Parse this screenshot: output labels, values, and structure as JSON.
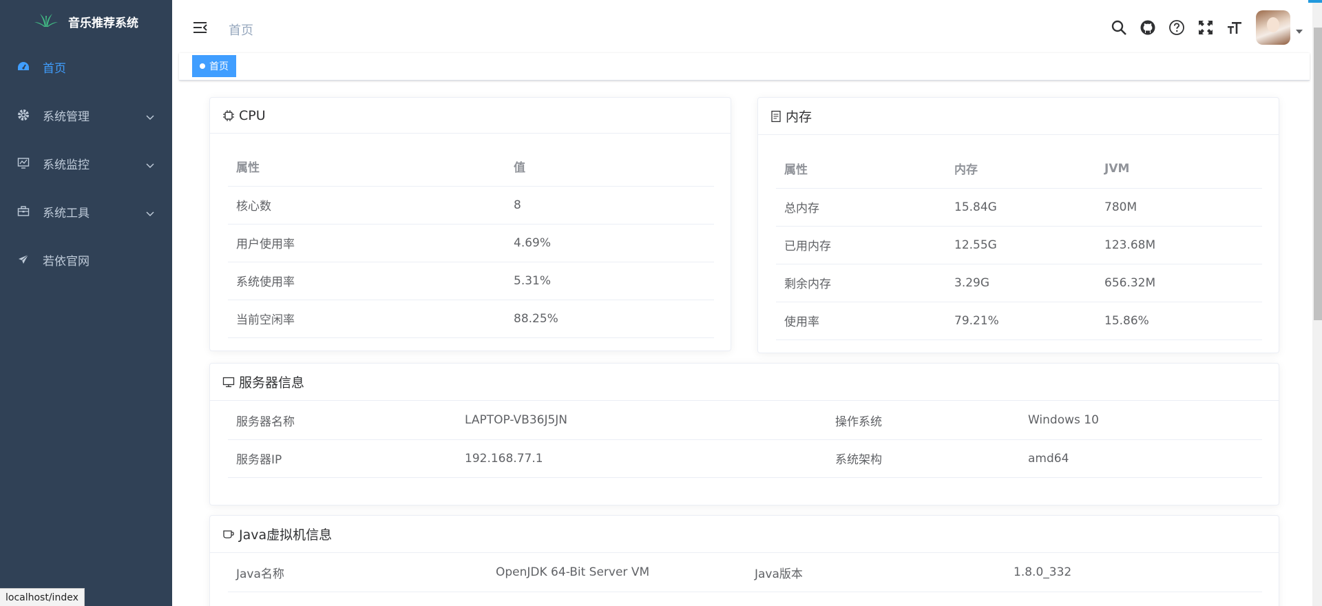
{
  "app": {
    "title": "音乐推荐系统"
  },
  "sidebar": {
    "items": [
      {
        "label": "首页",
        "icon": "dashboard-icon",
        "active": true
      },
      {
        "label": "系统管理",
        "icon": "gear-icon",
        "expandable": true
      },
      {
        "label": "系统监控",
        "icon": "monitor-icon",
        "expandable": true
      },
      {
        "label": "系统工具",
        "icon": "toolbox-icon",
        "expandable": true
      },
      {
        "label": "若依官网",
        "icon": "paper-plane-icon"
      }
    ]
  },
  "header": {
    "breadcrumb": "首页",
    "icons": [
      "search-icon",
      "github-icon",
      "question-icon",
      "fullscreen-icon",
      "font-size-icon"
    ]
  },
  "tags_view": {
    "tags": [
      {
        "label": "首页",
        "active": true
      }
    ]
  },
  "cpu": {
    "title": "CPU",
    "columns": [
      "属性",
      "值"
    ],
    "rows": [
      [
        "核心数",
        "8"
      ],
      [
        "用户使用率",
        "4.69%"
      ],
      [
        "系统使用率",
        "5.31%"
      ],
      [
        "当前空闲率",
        "88.25%"
      ]
    ]
  },
  "memory": {
    "title": "内存",
    "columns": [
      "属性",
      "内存",
      "JVM"
    ],
    "rows": [
      [
        "总内存",
        "15.84G",
        "780M"
      ],
      [
        "已用内存",
        "12.55G",
        "123.68M"
      ],
      [
        "剩余内存",
        "3.29G",
        "656.32M"
      ],
      [
        "使用率",
        "79.21%",
        "15.86%"
      ]
    ]
  },
  "server": {
    "title": "服务器信息",
    "rows": [
      [
        "服务器名称",
        "LAPTOP-VB36J5JN",
        "操作系统",
        "Windows 10"
      ],
      [
        "服务器IP",
        "192.168.77.1",
        "系统架构",
        "amd64"
      ]
    ]
  },
  "jvm": {
    "title": "Java虚拟机信息",
    "rows": [
      [
        "Java名称",
        "OpenJDK 64-Bit Server VM",
        "Java版本",
        "1.8.0_332"
      ]
    ]
  },
  "status_bar": {
    "url": "localhost/index"
  },
  "colors": {
    "sidebar_bg": "#304156",
    "accent": "#409eff",
    "sidebar_text": "#bfcbd9"
  }
}
